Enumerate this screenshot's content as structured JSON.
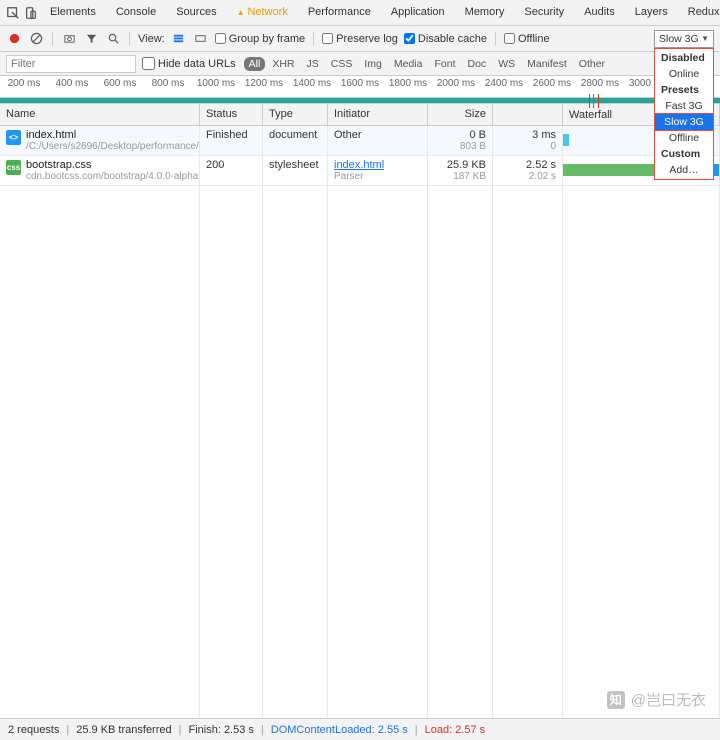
{
  "tabs": [
    "Elements",
    "Console",
    "Sources",
    "Network",
    "Performance",
    "Application",
    "Memory",
    "Security",
    "Audits",
    "Layers",
    "Redux"
  ],
  "activeTab": "Network",
  "toolbar": {
    "view": "View:",
    "groupByFrame": "Group by frame",
    "preserveLog": "Preserve log",
    "disableCache": "Disable cache",
    "offline": "Offline"
  },
  "throttle": {
    "selected": "Slow 3G",
    "groups": [
      {
        "header": "Disabled",
        "items": [
          "Online"
        ]
      },
      {
        "header": "Presets",
        "items": [
          "Fast 3G",
          "Slow 3G",
          "Offline"
        ]
      },
      {
        "header": "Custom",
        "items": [
          "Add…"
        ]
      }
    ]
  },
  "filter": {
    "placeholder": "Filter",
    "hideDataUrls": "Hide data URLs",
    "chips": [
      "All",
      "XHR",
      "JS",
      "CSS",
      "Img",
      "Media",
      "Font",
      "Doc",
      "WS",
      "Manifest",
      "Other"
    ]
  },
  "timelineTicks": [
    "200 ms",
    "400 ms",
    "600 ms",
    "800 ms",
    "1000 ms",
    "1200 ms",
    "1400 ms",
    "1600 ms",
    "1800 ms",
    "2000 ms",
    "2400 ms",
    "2600 ms",
    "2800 ms",
    "3000 ms",
    "3…"
  ],
  "columns": {
    "name": "Name",
    "status": "Status",
    "type": "Type",
    "initiator": "Initiator",
    "size": "Size",
    "time": "",
    "waterfall": "Waterfall"
  },
  "rows": [
    {
      "icon": "html",
      "iconTxt": "<>",
      "name": "index.html",
      "sub": "/C:/Users/s2696/Desktop/performance/…",
      "status": "Finished",
      "type": "document",
      "init": "Other",
      "initSub": "",
      "size": "0 B",
      "sizeSub": "803 B",
      "time": "3 ms",
      "timeSub": "0",
      "wf": {
        "left": 0,
        "width": 4,
        "color": "#4fc3f7"
      }
    },
    {
      "icon": "css",
      "iconTxt": "css",
      "name": "bootstrap.css",
      "sub": "cdn.bootcss.com/bootstrap/4.0.0-alpha…",
      "status": "200",
      "type": "stylesheet",
      "init": "index.html",
      "initSub": "Parser",
      "initLink": true,
      "size": "25.9 KB",
      "sizeSub": "187 KB",
      "time": "2.52 s",
      "timeSub": "2.02 s",
      "wf": {
        "left": 0,
        "width": 100,
        "grad": true
      }
    }
  ],
  "status": {
    "requests": "2 requests",
    "transferred": "25.9 KB transferred",
    "finish": "Finish: 2.53 s",
    "dcl": "DOMContentLoaded: 2.55 s",
    "load": "Load: 2.57 s"
  },
  "watermark": "@岂曰无衣"
}
